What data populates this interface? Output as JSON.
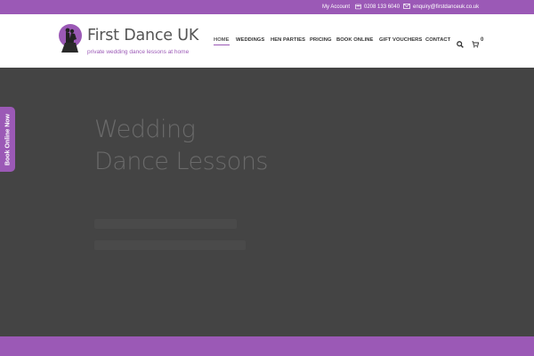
{
  "topbar": {
    "account_label": "My Account",
    "phone": "0208 133 6040",
    "email": "enquiry@firstdanceuk.co.uk",
    "phone_icon": "phone-icon",
    "email_icon": "envelope-icon"
  },
  "brand": {
    "name": "First Dance UK",
    "tagline": "private wedding dance lessons at home",
    "logo_icon": "dancing-couple-logo-icon",
    "accent_color": "#9b59b6"
  },
  "nav": {
    "items": [
      "HOME",
      "WEDDINGS",
      "HEN PARTIES",
      "PRICING",
      "BOOK ONLINE",
      "GIFT VOUCHERS",
      "CONTACT"
    ],
    "active": "HOME",
    "search_icon": "search-icon",
    "cart_icon": "cart-icon",
    "cart_count": "0"
  },
  "hero": {
    "title_line1": "Wedding",
    "title_line2": "Dance Lessons"
  },
  "side_tab": {
    "label": "Book Online Now"
  }
}
